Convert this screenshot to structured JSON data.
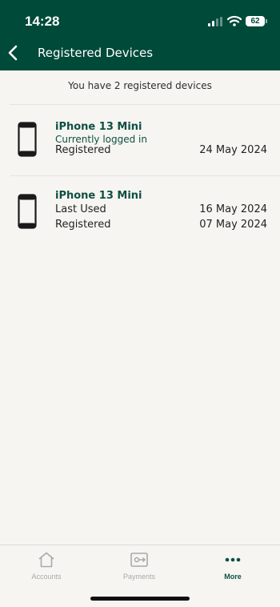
{
  "status_bar": {
    "time": "14:28",
    "battery": "62"
  },
  "header": {
    "title": "Registered Devices"
  },
  "summary": "You have 2 registered devices",
  "devices": [
    {
      "name": "iPhone 13 Mini",
      "status": "Currently logged in",
      "rows": [
        {
          "label": "Registered",
          "date": "24 May 2024"
        }
      ]
    },
    {
      "name": "iPhone 13 Mini",
      "rows": [
        {
          "label": "Last Used",
          "date": "16 May 2024"
        },
        {
          "label": "Registered",
          "date": "07 May 2024"
        }
      ]
    }
  ],
  "tabs": [
    {
      "label": "Accounts",
      "icon": "home-icon",
      "active": false
    },
    {
      "label": "Payments",
      "icon": "payments-icon",
      "active": false
    },
    {
      "label": "More",
      "icon": "more-icon",
      "active": true
    }
  ],
  "colors": {
    "brand": "#004a3a",
    "accent_text": "#0f4f43",
    "background": "#f6f5f2"
  }
}
